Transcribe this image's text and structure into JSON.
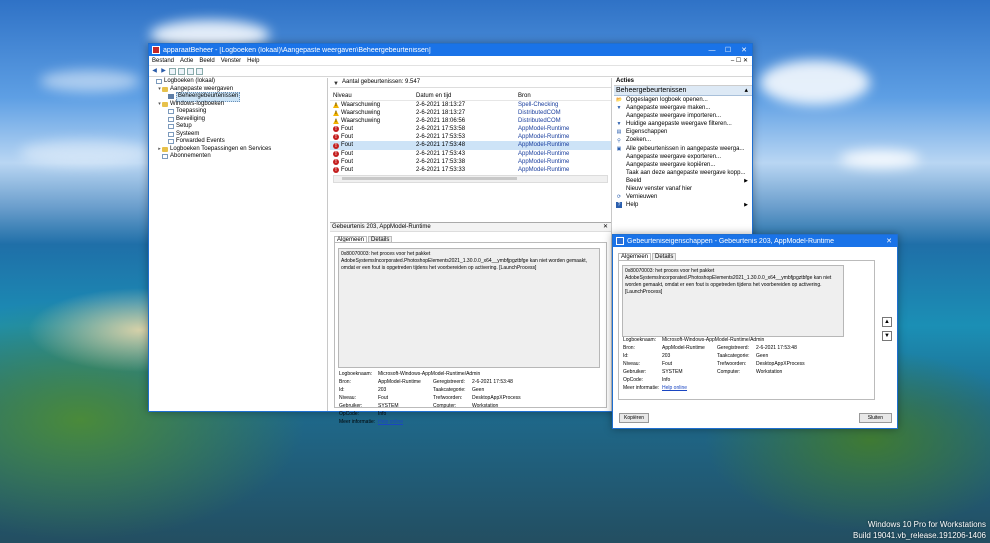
{
  "desktop": {
    "watermark_line1": "Windows 10 Pro for Workstations",
    "watermark_line2": "Build 19041.vb_release.191206-1406"
  },
  "mmc": {
    "title": "apparaatBeheer - [Logboeken (lokaal)\\Aangepaste weergaven\\Beheergebeurtenissen]",
    "menu": [
      "Bestand",
      "Actie",
      "Beeld",
      "Venster",
      "Help"
    ],
    "tree": [
      {
        "label": "Logboeken (lokaal)",
        "level": 0,
        "icon": "log-icon",
        "expander": ""
      },
      {
        "label": "Aangepaste weergaven",
        "level": 1,
        "icon": "folder-icon",
        "expander": "▾"
      },
      {
        "label": "Beheergebeurtenissen",
        "level": 2,
        "icon": "filter-icon",
        "expander": "",
        "selected": true
      },
      {
        "label": "Windows-logboeken",
        "level": 1,
        "icon": "folder-icon",
        "expander": "▾"
      },
      {
        "label": "Toepassing",
        "level": 2,
        "icon": "log-icon",
        "expander": ""
      },
      {
        "label": "Beveiliging",
        "level": 2,
        "icon": "log-icon",
        "expander": ""
      },
      {
        "label": "Setup",
        "level": 2,
        "icon": "log-icon",
        "expander": ""
      },
      {
        "label": "Systeem",
        "level": 2,
        "icon": "log-icon",
        "expander": ""
      },
      {
        "label": "Forwarded Events",
        "level": 2,
        "icon": "log-icon",
        "expander": ""
      },
      {
        "label": "Logboeken Toepassingen en Services",
        "level": 1,
        "icon": "folder-icon",
        "expander": "▸"
      },
      {
        "label": "Abonnementen",
        "level": 1,
        "icon": "log-icon",
        "expander": ""
      }
    ],
    "events_count": "Aantal gebeurtenissen: 9.547",
    "columns": [
      "Niveau",
      "Datum en tijd",
      "Bron"
    ],
    "events": [
      {
        "level": "Waarschuwing",
        "type": "warn",
        "date": "2-6-2021 18:13:27",
        "source": "Spell-Checking"
      },
      {
        "level": "Waarschuwing",
        "type": "warn",
        "date": "2-6-2021 18:13:27",
        "source": "DistributedCOM"
      },
      {
        "level": "Waarschuwing",
        "type": "warn",
        "date": "2-6-2021 18:06:56",
        "source": "DistributedCOM"
      },
      {
        "level": "Fout",
        "type": "err",
        "date": "2-6-2021 17:53:58",
        "source": "AppModel-Runtime"
      },
      {
        "level": "Fout",
        "type": "err",
        "date": "2-6-2021 17:53:53",
        "source": "AppModel-Runtime"
      },
      {
        "level": "Fout",
        "type": "err",
        "date": "2-6-2021 17:53:48",
        "source": "AppModel-Runtime",
        "selected": true
      },
      {
        "level": "Fout",
        "type": "err",
        "date": "2-6-2021 17:53:43",
        "source": "AppModel-Runtime"
      },
      {
        "level": "Fout",
        "type": "err",
        "date": "2-6-2021 17:53:38",
        "source": "AppModel-Runtime"
      },
      {
        "level": "Fout",
        "type": "err",
        "date": "2-6-2021 17:53:33",
        "source": "AppModel-Runtime"
      }
    ],
    "detail_title": "Gebeurtenis 203, AppModel-Runtime",
    "tab_general": "Algemeen",
    "tab_details": "Details",
    "message": "0x80070003: het proces voor het pakket AdobeSystemsIncorporated.PhotoshopElements2021_1.30.0.0_x64__ymbfjpgztbfge kan niet worden gemaakt, omdat er een fout is opgetreden tijdens het voorbereiden op activering. [LaunchProcess]",
    "props": {
      "log_name_label": "Logboeknaam:",
      "log_name": "Microsoft-Windows-AppModel-Runtime/Admin",
      "source_label": "Bron:",
      "source": "AppModel-Runtime",
      "logged_label": "Geregistreerd:",
      "logged": "2-6-2021 17:53:48",
      "id_label": "Id:",
      "id": "203",
      "task_label": "Taakcategorie:",
      "task": "Geen",
      "level_label": "Niveau:",
      "level": "Fout",
      "keywords_label": "Trefwoorden:",
      "keywords": "DesktopAppXProcess",
      "user_label": "Gebruiker:",
      "user": "SYSTEM",
      "computer_label": "Computer:",
      "computer": "Workstation",
      "opcode_label": "OpCode:",
      "opcode": "Info",
      "more_label": "Meer informatie:",
      "more_link": "Help online"
    },
    "actions_title": "Acties",
    "actions_section": "Beheergebeurtenissen",
    "actions": [
      {
        "label": "Opgeslagen logboek openen...",
        "icon": "open-log-icon",
        "glyph": "📂",
        "sub": ""
      },
      {
        "label": "Aangepaste weergave maken...",
        "icon": "filter-icon",
        "glyph": "▼",
        "sub": ""
      },
      {
        "label": "Aangepaste weergave importeren...",
        "icon": "blank-icon",
        "glyph": "",
        "sub": ""
      },
      {
        "label": "Huidige aangepaste weergave filteren...",
        "icon": "filter-icon",
        "glyph": "▼",
        "sub": ""
      },
      {
        "label": "Eigenschappen",
        "icon": "properties-icon",
        "glyph": "▤",
        "sub": ""
      },
      {
        "label": "Zoeken...",
        "icon": "find-icon",
        "glyph": "⚲",
        "sub": ""
      },
      {
        "label": "Alle gebeurtenissen in aangepaste weerga...",
        "icon": "save-icon",
        "glyph": "▣",
        "sub": ""
      },
      {
        "label": "Aangepaste weergave exporteren...",
        "icon": "blank-icon",
        "glyph": "",
        "sub": ""
      },
      {
        "label": "Aangepaste weergave kopiëren...",
        "icon": "blank-icon",
        "glyph": "",
        "sub": ""
      },
      {
        "label": "Taak aan deze aangepaste weergave kopp...",
        "icon": "blank-icon",
        "glyph": "",
        "sub": ""
      },
      {
        "label": "Beeld",
        "icon": "blank-icon",
        "glyph": "",
        "sub": "▶"
      },
      {
        "label": "Nieuw venster vanaf hier",
        "icon": "blank-icon",
        "glyph": "",
        "sub": ""
      },
      {
        "label": "Vernieuwen",
        "icon": "refresh-icon",
        "glyph": "⟳",
        "sub": ""
      },
      {
        "label": "Help",
        "icon": "help-icon",
        "glyph": "?",
        "sub": "▶"
      }
    ]
  },
  "dialog": {
    "title": "Gebeurteniseigenschappen - Gebeurtenis 203, AppModel-Runtime",
    "tab_general": "Algemeen",
    "tab_details": "Details",
    "message": "0x80070003: het proces voor het pakket AdobeSystemsIncorporated.PhotoshopElements2021_1.30.0.0_x64__ymbfjpgztbfge kan niet worden gemaakt, omdat er een fout is opgetreden tijdens het voorbereiden op activering. [LaunchProcess]",
    "copy_button": "Kopiëren",
    "close_button": "Sluiten"
  },
  "colors": {
    "accent": "#1a73e8",
    "error": "#c41e1e",
    "warning": "#f2b300"
  }
}
